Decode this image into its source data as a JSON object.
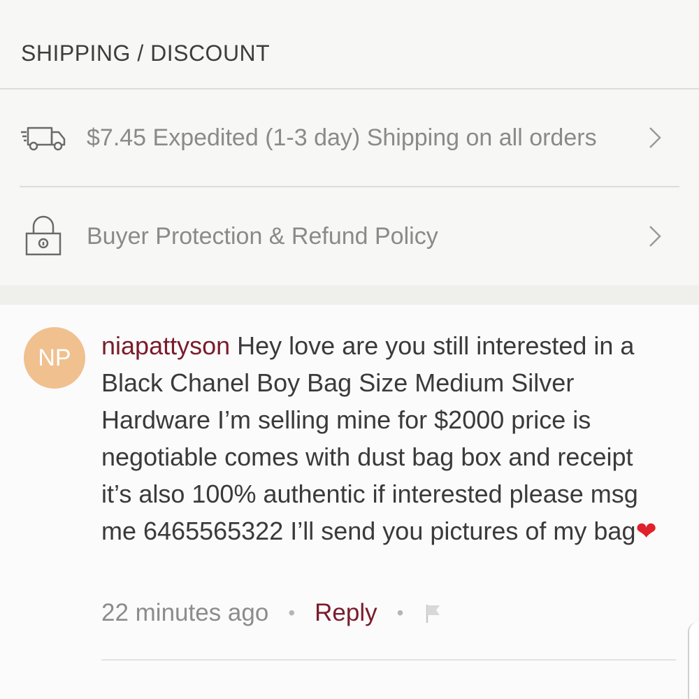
{
  "section": {
    "title": "SHIPPING / DISCOUNT"
  },
  "shipping_row": {
    "label": "$7.45 Expedited (1-3 day) Shipping on all orders",
    "icon": "truck-icon"
  },
  "protection_row": {
    "label": "Buyer Protection & Refund Policy",
    "icon": "lock-icon"
  },
  "comment": {
    "avatar_initials": "NP",
    "username": "niapattyson",
    "text": " Hey love are you still interested in a Black Chanel Boy Bag Size Medium Silver Hardware I’m selling mine for $2000 price is negotiable comes with dust bag box and receipt it’s also 100% authentic if interested please msg me 6465565322 I’ll send you pictures of my bag",
    "emoji": "❤",
    "time": "22 minutes ago",
    "reply_label": "Reply",
    "separator": "•"
  },
  "colors": {
    "accent": "#7a1c2b",
    "avatar_bg": "#f0c08f",
    "heart": "#e0202a"
  }
}
